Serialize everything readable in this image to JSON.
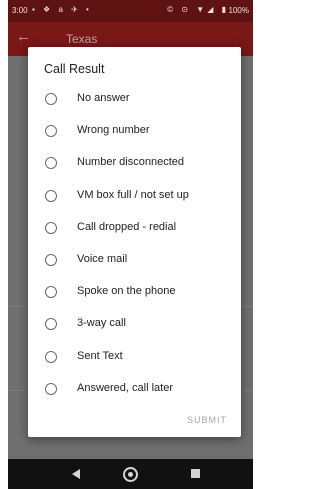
{
  "status_bar": {
    "time": "3:00",
    "left_icons": "▪ ❖ a ✈ •",
    "right_icons": "© ⊙ ▼◢ ▮",
    "battery": "100%"
  },
  "app_bar": {
    "back_icon": "←",
    "title": "Texas"
  },
  "dialog": {
    "title": "Call Result",
    "options": [
      {
        "label": "No answer"
      },
      {
        "label": "Wrong number"
      },
      {
        "label": "Number disconnected"
      },
      {
        "label": "VM box full / not set up"
      },
      {
        "label": "Call dropped - redial"
      },
      {
        "label": "Voice mail"
      },
      {
        "label": "Spoke on the phone"
      },
      {
        "label": "3-way call"
      },
      {
        "label": "Sent Text"
      },
      {
        "label": "Answered,  call later"
      }
    ],
    "submit_label": "SUBMIT"
  },
  "colors": {
    "status_bar": "#5e1212",
    "app_bar": "#7a1717",
    "scrim": "#6f6f6f",
    "submit_disabled": "#a7a7a7"
  }
}
